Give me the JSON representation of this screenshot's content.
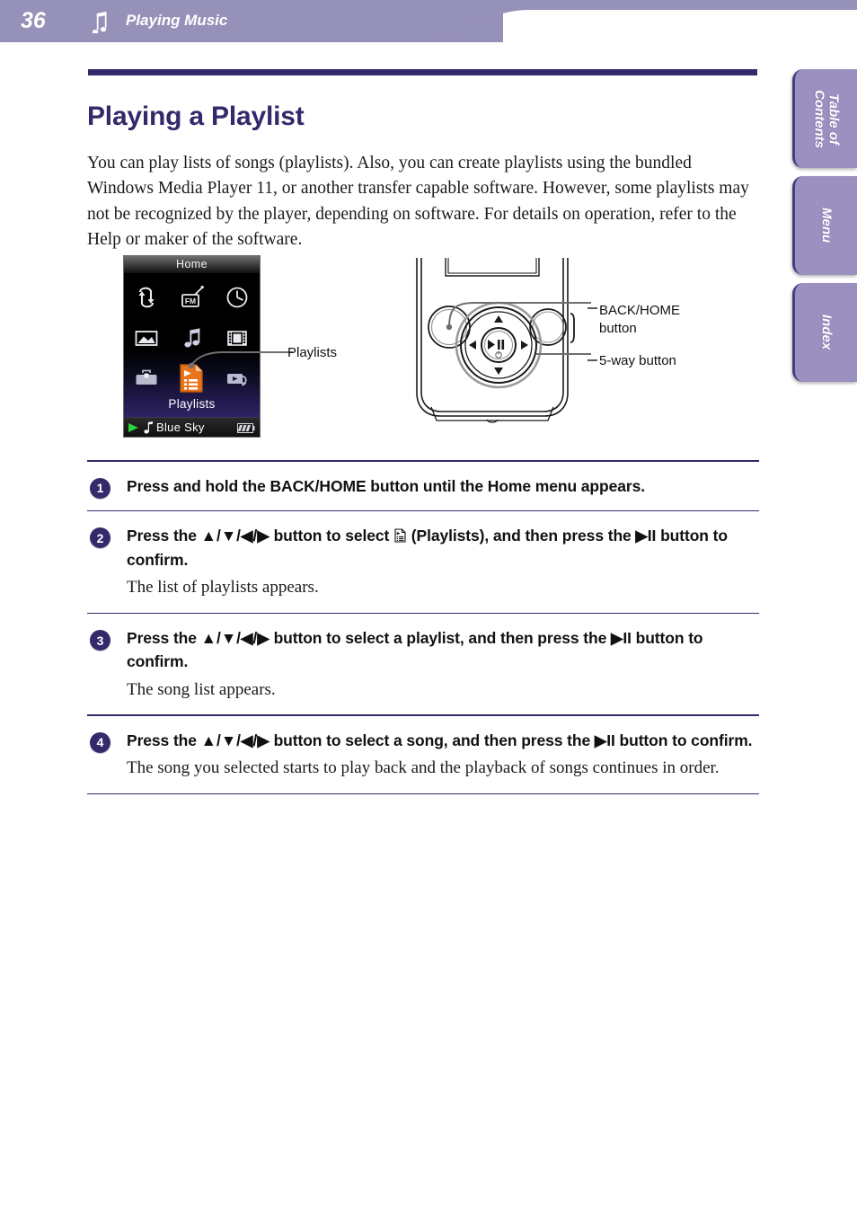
{
  "header": {
    "page_number": "36",
    "title": "Playing Music",
    "note_icon": "music-note-icon",
    "band_color": "#9691b8"
  },
  "side_tabs": [
    {
      "label": "Table of\nContents",
      "name": "tab-table-of-contents"
    },
    {
      "label": "Menu",
      "name": "tab-menu"
    },
    {
      "label": "Index",
      "name": "tab-index"
    }
  ],
  "page": {
    "title": "Playing a Playlist",
    "title_color": "#322a6b",
    "intro": "You can play lists of songs (playlists). Also, you can create playlists using the bundled Windows Media Player 11, or another transfer capable software. However, some playlists may not be recognized by the player, depending on software. For details on operation, refer to the Help or maker of the software."
  },
  "device_screen": {
    "titlebar": "Home",
    "selected_label": "Playlists",
    "icons": [
      {
        "name": "playback-history-icon",
        "label": ""
      },
      {
        "name": "fm-radio-icon",
        "label": "FM"
      },
      {
        "name": "clock-icon",
        "label": ""
      },
      {
        "name": "photo-icon",
        "label": ""
      },
      {
        "name": "music-icon",
        "label": ""
      },
      {
        "name": "video-icon",
        "label": ""
      },
      {
        "name": "settings-toolbox-icon",
        "label": ""
      },
      {
        "name": "playlists-icon",
        "label": ""
      },
      {
        "name": "playback-mode-icon",
        "label": ""
      }
    ],
    "status": {
      "play_icon": "play-triangle-icon",
      "note_icon": "music-note-icon",
      "song": "Blue Sky",
      "battery_icon": "battery-icon"
    },
    "callout": "Playlists",
    "selected_icon_color": "#e8741c"
  },
  "device_callouts": {
    "backhome": "BACK/HOME\nbutton",
    "backhome_line1": "BACK/HOME",
    "backhome_line2": "button",
    "fiveway": "5-way button"
  },
  "steps": [
    {
      "num": "1",
      "head_parts": [
        "Press and hold the BACK/HOME button until the Home menu appears."
      ],
      "desc": ""
    },
    {
      "num": "2",
      "head_pre": "Press the ",
      "head_arrows": "▲/▼/◀/▶",
      "head_mid": " button to select ",
      "head_post": " (Playlists), and then press the ▶II button to confirm.",
      "desc": "The list of playlists appears."
    },
    {
      "num": "3",
      "head_pre": "Press the ",
      "head_arrows": "▲/▼/◀/▶",
      "head_post": " button to select a playlist, and then press the ▶II button to confirm.",
      "desc": "The song list appears."
    },
    {
      "num": "4",
      "head_pre": "Press the ",
      "head_arrows": "▲/▼/◀/▶",
      "head_post": " button to select a song, and then press the ▶II button to confirm.",
      "desc": "The song you selected starts to play back and the playback of songs continues in order."
    }
  ]
}
